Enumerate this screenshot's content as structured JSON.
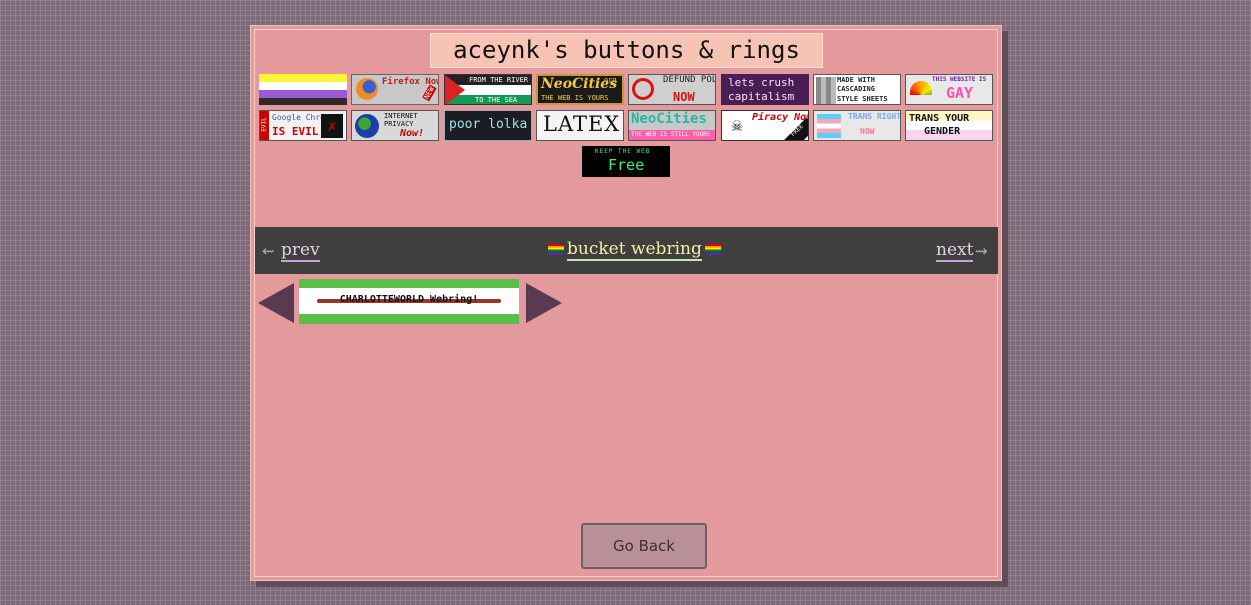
{
  "title": "aceynk's buttons & rings",
  "buttons_row1": [
    {
      "name": "nonbinary-flag-button",
      "text": ""
    },
    {
      "name": "firefox-now-button",
      "text": "Firefox Now!",
      "tag": "NEW"
    },
    {
      "name": "from-the-river-button",
      "text": "FROM THE RIVER",
      "sub": "TO THE SEA"
    },
    {
      "name": "neocities-button",
      "text": "NeoCities",
      "sub": "THE WEB IS YOURS",
      "corner": "org"
    },
    {
      "name": "defund-police-button",
      "text": "DEFUND POLICE",
      "sub": "NOW"
    },
    {
      "name": "lets-crush-capitalism-button",
      "text": "lets crush",
      "sub": "capitalism"
    },
    {
      "name": "cascading-style-sheets-button",
      "text": "MADE WITH CASCADING",
      "sub": "STYLE SHEETS"
    },
    {
      "name": "this-website-is-gay-button",
      "text": "THIS WEBSITE IS",
      "sub": "GAY"
    }
  ],
  "buttons_row2": [
    {
      "name": "google-chrome-evil-button",
      "text": "Google Chrome",
      "sub": "IS EVIL!",
      "side": "EVIL"
    },
    {
      "name": "internet-privacy-button",
      "text": "INTERNET PRIVACY",
      "sub": "Now!"
    },
    {
      "name": "poor-lolka-button",
      "text": "poor lolka"
    },
    {
      "name": "latex-button",
      "text": "LATEX"
    },
    {
      "name": "neocities-still-yours-button",
      "text": "NeoCities",
      "sub": "THE WEB IS STILL YOURS"
    },
    {
      "name": "piracy-now-button",
      "text": "Piracy Now!",
      "tag": "FREE"
    },
    {
      "name": "trans-rights-now-button",
      "text": "TRANS RIGHTS",
      "sub": "NOW"
    },
    {
      "name": "trans-your-gender-button",
      "text": "TRANS YOUR",
      "sub": "GENDER"
    }
  ],
  "keep_web_free": {
    "text": "KEEP THE WEB",
    "sub": "Free"
  },
  "webring": {
    "prev_arrow": "⇜",
    "prev_label": "prev",
    "center_label": "bucket webring",
    "next_label": "next",
    "next_arrow": "⇝"
  },
  "charlotte_ring": {
    "label": "CHARLOTTEWORLD Webring!"
  },
  "go_back": "Go Back"
}
